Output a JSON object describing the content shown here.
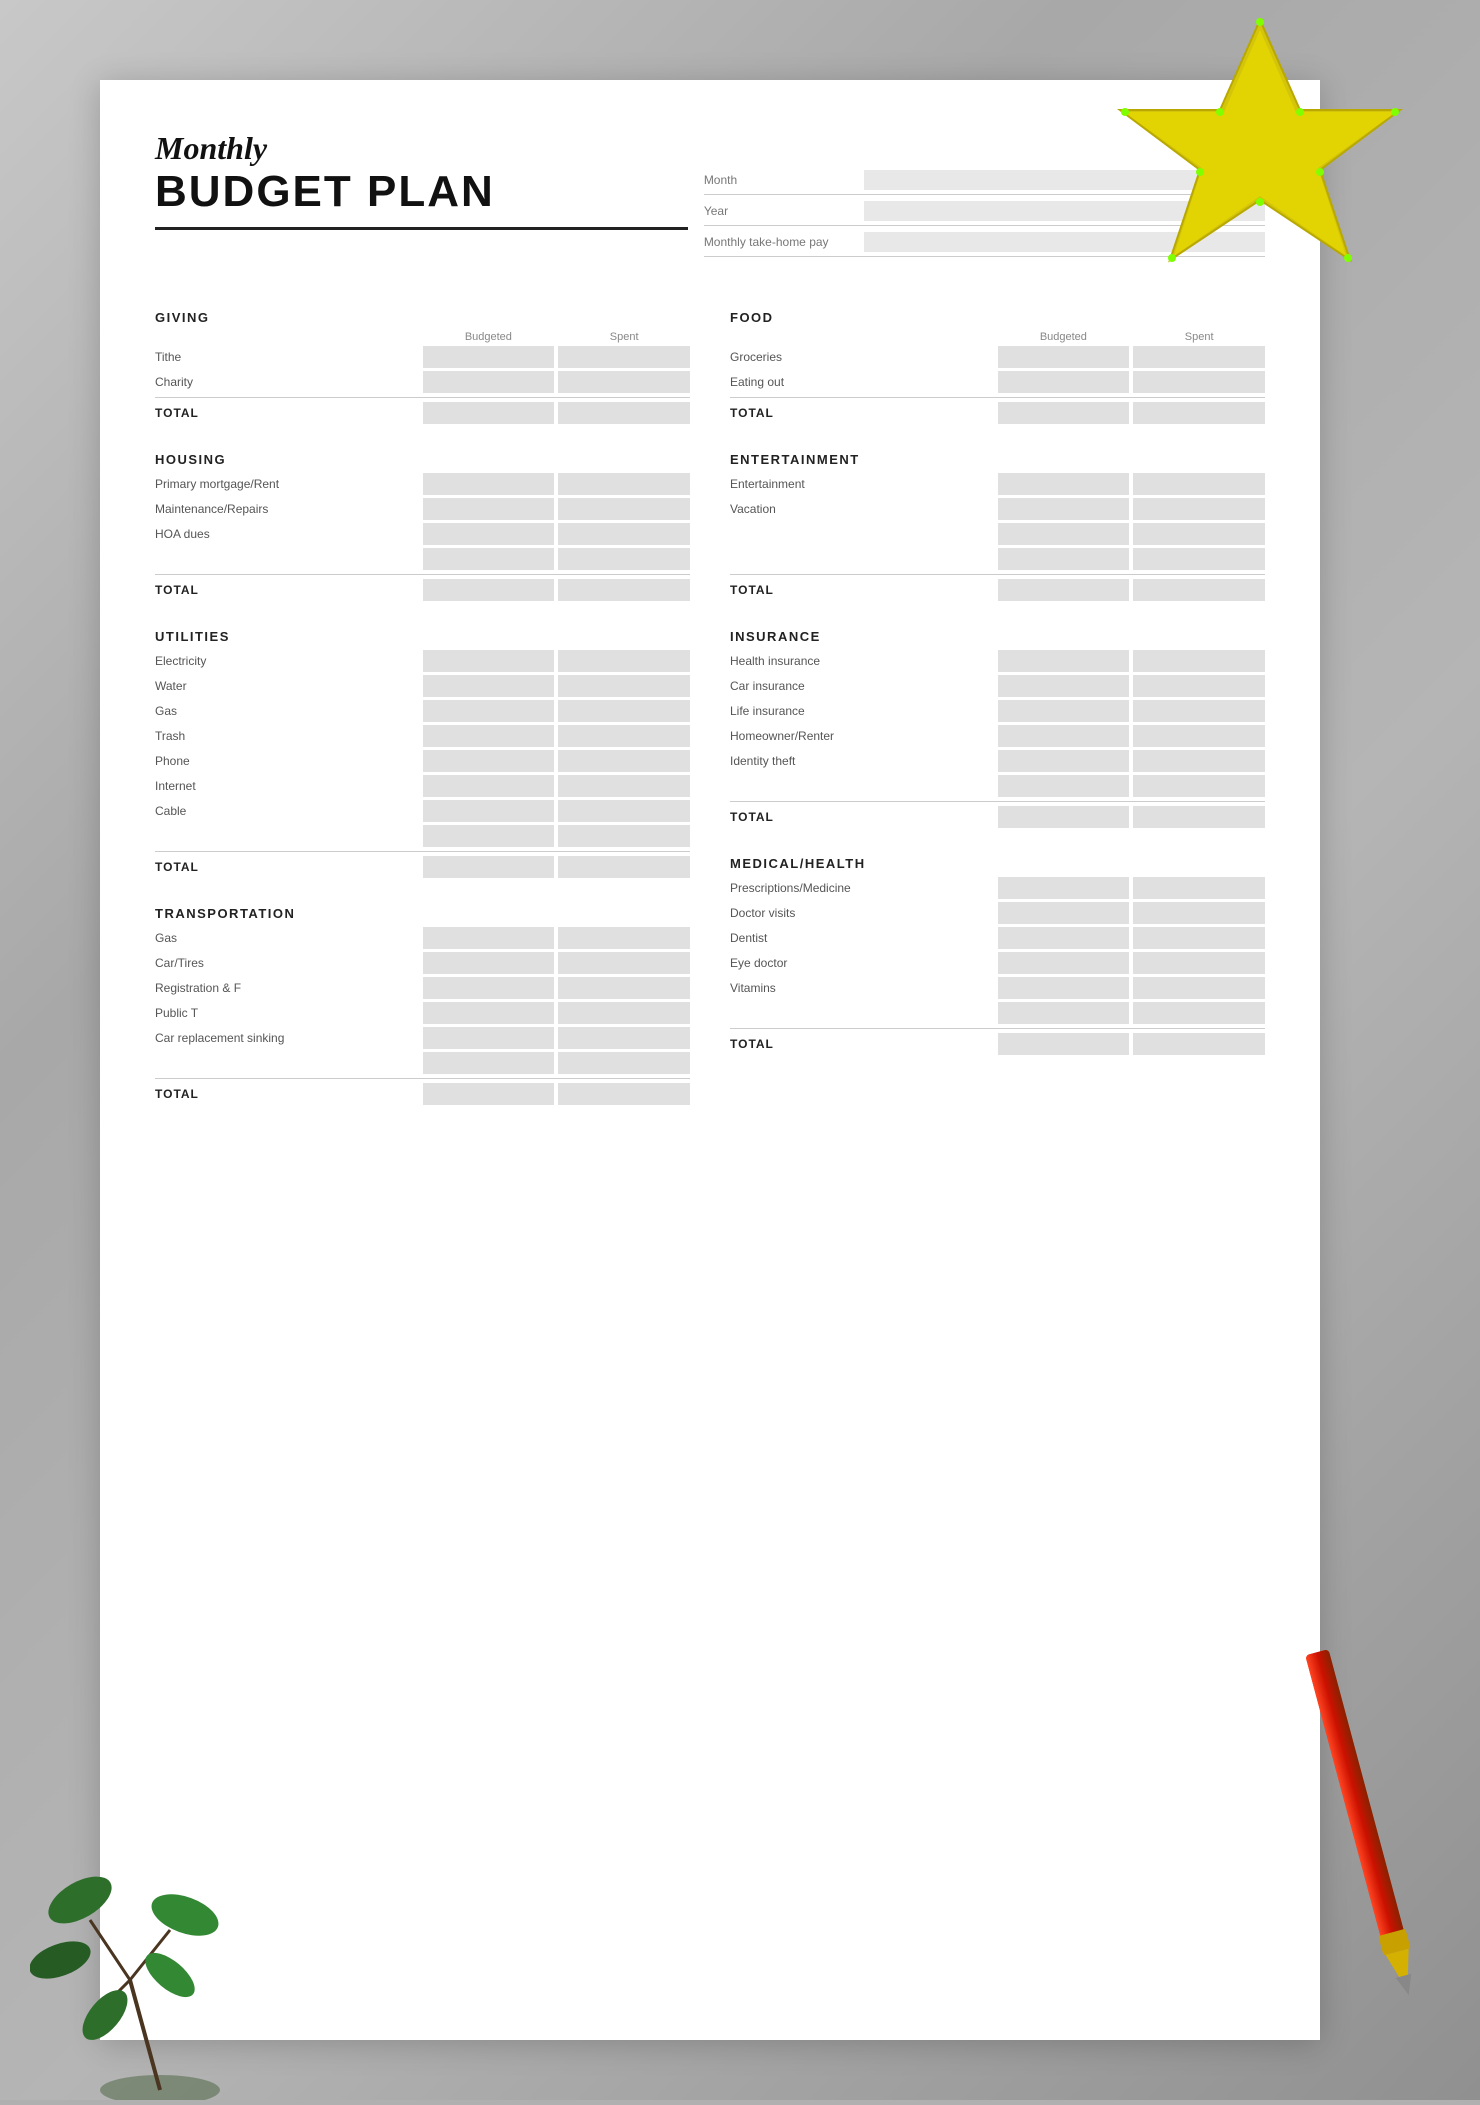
{
  "background": {
    "color": "#b0b0b0"
  },
  "header": {
    "title_monthly": "Monthly",
    "title_budget": "BUDGET PLAN"
  },
  "meta": {
    "fields": [
      {
        "label": "Month",
        "value": ""
      },
      {
        "label": "Year",
        "value": ""
      },
      {
        "label": "Monthly take-home pay",
        "value": ""
      }
    ]
  },
  "sections": {
    "giving": {
      "title": "GIVING",
      "col_budgeted": "Budgeted",
      "col_spent": "Spent",
      "rows": [
        "Tithe",
        "Charity"
      ],
      "extra_empty": 0,
      "total": "TOTAL"
    },
    "food": {
      "title": "FOOD",
      "col_budgeted": "Budgeted",
      "col_spent": "Spent",
      "rows": [
        "Groceries",
        "Eating out"
      ],
      "extra_empty": 0,
      "total": "TOTAL"
    },
    "housing": {
      "title": "HOUSING",
      "rows": [
        "Primary mortgage/Rent",
        "Maintenance/Repairs",
        "HOA dues",
        ""
      ],
      "total": "TOTAL"
    },
    "entertainment": {
      "title": "ENTERTAINMENT",
      "rows": [
        "Entertainment",
        "Vacation",
        "",
        ""
      ],
      "total": "TOTAL"
    },
    "utilities": {
      "title": "UTILITIES",
      "rows": [
        "Electricity",
        "Water",
        "Gas",
        "Trash",
        "Phone",
        "Internet",
        "Cable",
        ""
      ],
      "total": "TOTAL"
    },
    "insurance": {
      "title": "INSURANCE",
      "rows": [
        "Health insurance",
        "Car insurance",
        "Life insurance",
        "Homeowner/Renter",
        "Identity theft",
        ""
      ],
      "total": "TOTAL"
    },
    "transportation": {
      "title": "TRANSPORTATION",
      "rows": [
        "Gas",
        "Car/Tires",
        "Registration & F",
        "Public T",
        "Car replacement sinking",
        ""
      ],
      "total": "TOTAL"
    },
    "medical": {
      "title": "MEDICAL/HEALTH",
      "rows": [
        "Prescriptions/Medicine",
        "Doctor visits",
        "Dentist",
        "Eye doctor",
        "Vitamins",
        ""
      ],
      "total": "TOTAL"
    }
  }
}
